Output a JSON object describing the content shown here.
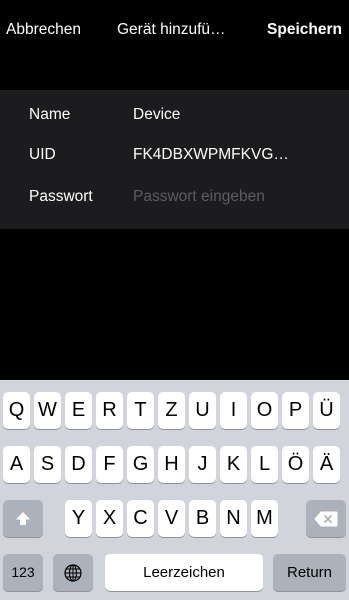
{
  "navbar": {
    "cancel_label": "Abbrechen",
    "title": "Gerät hinzufü…",
    "save_label": "Speichern"
  },
  "form": {
    "name": {
      "label": "Name",
      "value": "Device"
    },
    "uid": {
      "label": "UID",
      "value": "FK4DBXWPMFKVG…"
    },
    "password": {
      "label": "Passwort",
      "placeholder": "Passwort eingeben"
    }
  },
  "keyboard": {
    "row1": [
      "Q",
      "W",
      "E",
      "R",
      "T",
      "Z",
      "U",
      "I",
      "O",
      "P",
      "Ü"
    ],
    "row2": [
      "A",
      "S",
      "D",
      "F",
      "G",
      "H",
      "J",
      "K",
      "L",
      "Ö",
      "Ä"
    ],
    "row3": [
      "Y",
      "X",
      "C",
      "V",
      "B",
      "N",
      "M"
    ],
    "numbers_label": "123",
    "space_label": "Leerzeichen",
    "return_label": "Return",
    "shift_icon": "shift-arrow-icon",
    "backspace_icon": "backspace-icon",
    "globe_icon": "globe-icon"
  },
  "colors": {
    "background": "#000000",
    "form_background": "#1c1c1e",
    "placeholder": "#5d5d5f",
    "keyboard_background": "#d1d5db",
    "key_background": "#ffffff",
    "special_key_background": "#abb2bc"
  }
}
